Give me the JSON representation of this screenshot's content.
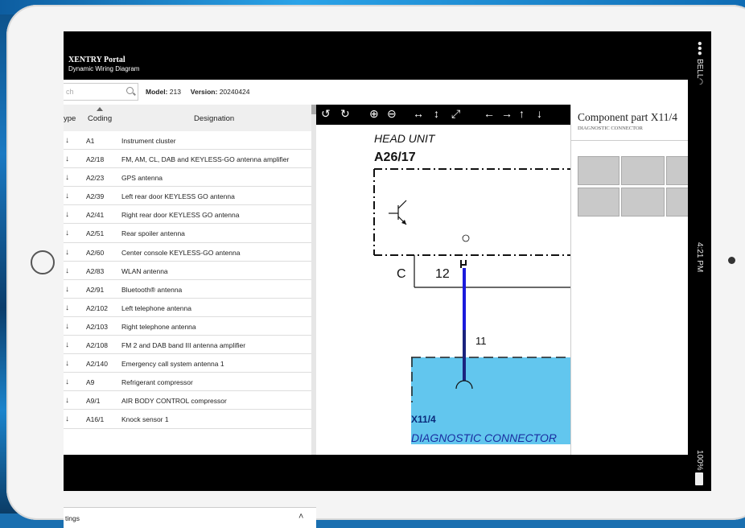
{
  "app": {
    "title": "XENTRY Portal",
    "subtitle": "Dynamic Wiring Diagram"
  },
  "toolbar": {
    "search_placeholder": "ch",
    "model_label": "Model:",
    "model_value": "213",
    "version_label": "Version:",
    "version_value": "20240424"
  },
  "table": {
    "headers": {
      "type": "ype",
      "coding": "Coding",
      "designation": "Designation"
    },
    "rows": [
      {
        "type": "↓",
        "code": "A1",
        "designation": "Instrument cluster"
      },
      {
        "type": "↓",
        "code": "A2/18",
        "designation": "FM, AM, CL, DAB and KEYLESS-GO antenna amplifier"
      },
      {
        "type": "↓",
        "code": "A2/23",
        "designation": "GPS antenna"
      },
      {
        "type": "↓",
        "code": "A2/39",
        "designation": "Left rear door KEYLESS GO antenna"
      },
      {
        "type": "↓",
        "code": "A2/41",
        "designation": "Right rear door KEYLESS GO antenna"
      },
      {
        "type": "↓",
        "code": "A2/51",
        "designation": "Rear spoiler antenna"
      },
      {
        "type": "↓",
        "code": "A2/60",
        "designation": "Center console KEYLESS-GO antenna"
      },
      {
        "type": "↓",
        "code": "A2/83",
        "designation": "WLAN antenna"
      },
      {
        "type": "↓",
        "code": "A2/91",
        "designation": "Bluetooth® antenna"
      },
      {
        "type": "↓",
        "code": "A2/102",
        "designation": "Left telephone antenna"
      },
      {
        "type": "↓",
        "code": "A2/103",
        "designation": "Right telephone antenna"
      },
      {
        "type": "↓",
        "code": "A2/108",
        "designation": "FM 2 and DAB band III antenna amplifier"
      },
      {
        "type": "↓",
        "code": "A2/140",
        "designation": "Emergency call system antenna 1"
      },
      {
        "type": "↓",
        "code": "A9",
        "designation": "Refrigerant compressor"
      },
      {
        "type": "↓",
        "code": "A9/1",
        "designation": "AIR BODY CONTROL compressor"
      },
      {
        "type": "↓",
        "code": "A16/1",
        "designation": "Knock sensor 1"
      }
    ],
    "footer_label": "tings",
    "footer_icon": "double-chevron-up-icon"
  },
  "diagram": {
    "tools": [
      "↺",
      "↻",
      "⊕",
      "⊖",
      "↔",
      "↕",
      "⤢",
      "←",
      "→",
      "↑",
      "↓"
    ],
    "head_unit_label": "HEAD UNIT",
    "head_unit_code": "A26/17",
    "conn_letter": "C",
    "pin_number": "12",
    "wire_number": "11",
    "marker": "①",
    "target_code": "X11/4",
    "target_label": "DIAGNOSTIC CONNECTOR",
    "colors": {
      "wire": "#1a1adc",
      "wire_dark": "#1a237e",
      "target_fill": "#62c6ee"
    }
  },
  "component": {
    "title": "Component part X11/4",
    "subtitle": "DIAGNOSTIC CONNECTOR"
  },
  "status": {
    "carrier": "BELL",
    "time": "4:21 PM",
    "battery": "100%"
  }
}
